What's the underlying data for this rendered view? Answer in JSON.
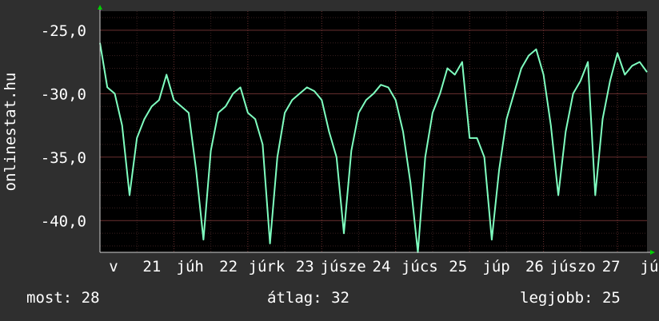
{
  "chart_data": {
    "type": "line",
    "ylabel": "onlinestat.hu",
    "ylim": [
      -42.5,
      -23.5
    ],
    "y_ticks": [
      "-25,0",
      "-30,0",
      "-35,0",
      "-40,0"
    ],
    "y_tick_values": [
      -25,
      -30,
      -35,
      -40
    ],
    "x_tick_labels": [
      "v",
      "21",
      "júh",
      "22",
      "júrk",
      "23",
      "júsze",
      "24",
      "júcs",
      "25",
      "júp",
      "26",
      "júszo",
      "27",
      "jú"
    ],
    "x_range": [
      0,
      7.4
    ],
    "grid": true,
    "series": [
      {
        "color": "#7fffc0",
        "x": [
          0,
          0.1,
          0.2,
          0.3,
          0.4,
          0.5,
          0.6,
          0.7,
          0.8,
          0.9,
          1.0,
          1.1,
          1.2,
          1.3,
          1.4,
          1.5,
          1.6,
          1.7,
          1.8,
          1.9,
          2.0,
          2.1,
          2.2,
          2.3,
          2.4,
          2.5,
          2.6,
          2.7,
          2.8,
          2.9,
          3.0,
          3.1,
          3.2,
          3.3,
          3.4,
          3.5,
          3.6,
          3.7,
          3.8,
          3.9,
          4.0,
          4.1,
          4.2,
          4.3,
          4.4,
          4.5,
          4.6,
          4.7,
          4.8,
          4.9,
          5.0,
          5.1,
          5.2,
          5.3,
          5.4,
          5.5,
          5.6,
          5.7,
          5.8,
          5.9,
          6.0,
          6.1,
          6.2,
          6.3,
          6.4,
          6.5,
          6.6,
          6.7,
          6.8,
          6.9,
          7.0,
          7.1,
          7.2,
          7.3,
          7.4
        ],
        "values": [
          -26.0,
          -29.5,
          -30.0,
          -32.5,
          -38.0,
          -33.5,
          -32.0,
          -31.0,
          -30.5,
          -28.5,
          -30.5,
          -31.0,
          -31.5,
          -36.0,
          -41.5,
          -34.5,
          -31.5,
          -31.0,
          -30.0,
          -29.5,
          -31.5,
          -32.0,
          -34.0,
          -41.8,
          -35.0,
          -31.5,
          -30.5,
          -30.0,
          -29.5,
          -29.8,
          -30.5,
          -33.0,
          -35.0,
          -41.0,
          -34.5,
          -31.5,
          -30.5,
          -30.0,
          -29.3,
          -29.5,
          -30.5,
          -33.0,
          -37.0,
          -42.5,
          -35.0,
          -31.5,
          -30.0,
          -28.0,
          -28.5,
          -27.5,
          -33.5,
          -33.5,
          -35.0,
          -41.5,
          -36.0,
          -32.0,
          -30.0,
          -28.0,
          -27.0,
          -26.5,
          -28.5,
          -32.5,
          -38.0,
          -33.0,
          -30.0,
          -29.0,
          -27.5,
          -38.0,
          -32.0,
          -29.0,
          -26.8,
          -28.5,
          -27.8,
          -27.5,
          -28.3
        ]
      }
    ]
  },
  "footer": {
    "most": "most: 28",
    "atlag": "átlag: 32",
    "legjobb": "legjobb: 25"
  }
}
